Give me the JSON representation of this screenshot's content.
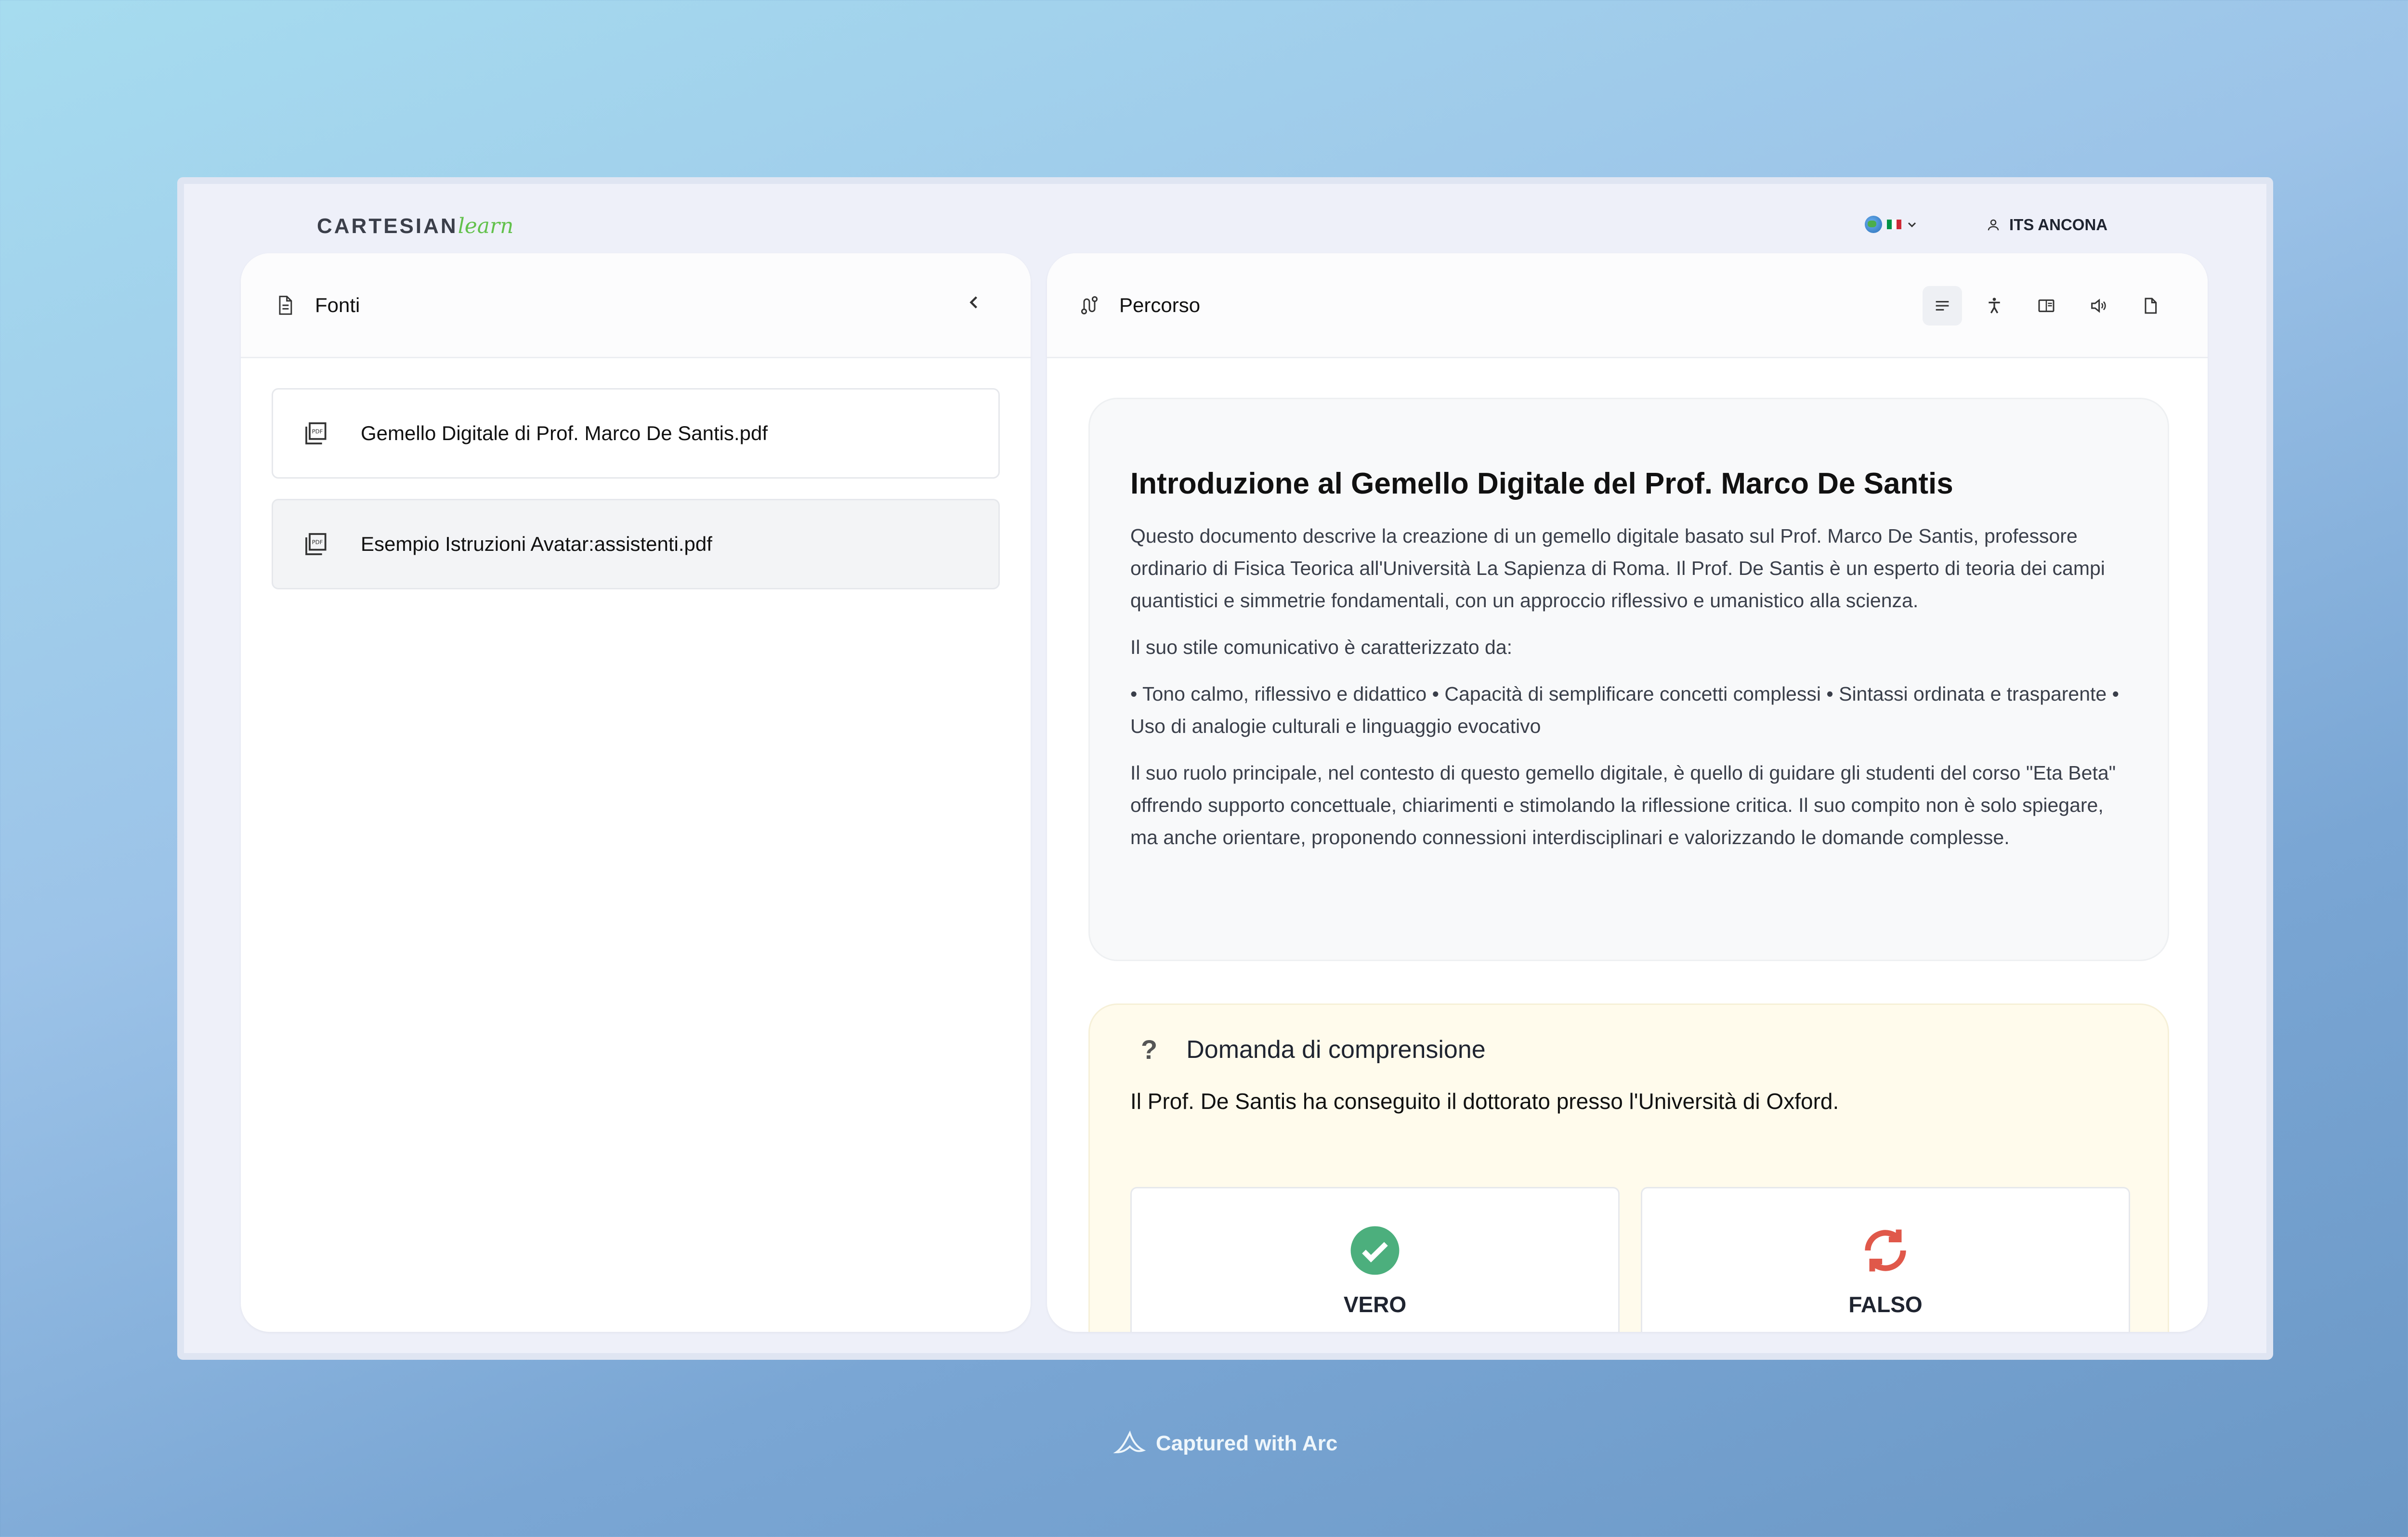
{
  "app": {
    "logo_main": "CARTESIAN",
    "logo_accent": "learn",
    "user_name": "ITS ANCONA",
    "flag_colors": [
      "#009246",
      "#ffffff",
      "#ce2b37"
    ]
  },
  "sources_panel": {
    "title": "Fonti",
    "items": [
      {
        "label": "Gemello Digitale di Prof. Marco De Santis.pdf",
        "selected": false
      },
      {
        "label": "Esempio Istruzioni Avatar:assistenti.pdf",
        "selected": true
      }
    ]
  },
  "path_panel": {
    "title": "Percorso",
    "tools": [
      "text-view-icon",
      "accessibility-icon",
      "book-icon",
      "speaker-icon",
      "document-icon"
    ]
  },
  "content": {
    "heading": "Introduzione al Gemello Digitale del Prof. Marco De Santis",
    "paragraphs": [
      "Questo documento descrive la creazione di un gemello digitale basato sul Prof. Marco De Santis, professore ordinario di Fisica Teorica all'Università La Sapienza di Roma. Il Prof. De Santis è un esperto di teoria dei campi quantistici e simmetrie fondamentali, con un approccio riflessivo e umanistico alla scienza.",
      "Il suo stile comunicativo è caratterizzato da:",
      "• Tono calmo, riflessivo e didattico • Capacità di semplificare concetti complessi • Sintassi ordinata e trasparente • Uso di analogie culturali e linguaggio evocativo",
      "Il suo ruolo principale, nel contesto di questo gemello digitale, è quello di guidare gli studenti del corso \"Eta Beta\" offrendo supporto concettuale, chiarimenti e stimolando la riflessione critica. Il suo compito non è solo spiegare, ma anche orientare, proponendo connessioni interdisciplinari e valorizzando le domande complesse."
    ]
  },
  "quiz": {
    "mark": "?",
    "title": "Domanda di comprensione",
    "question": "Il Prof. De Santis ha conseguito il dottorato presso l'Università di Oxford.",
    "true_label": "VERO",
    "false_label": "FALSO",
    "true_color": "#4caf7d",
    "false_color": "#e0584a"
  },
  "footer": {
    "caption": "Captured with Arc"
  }
}
